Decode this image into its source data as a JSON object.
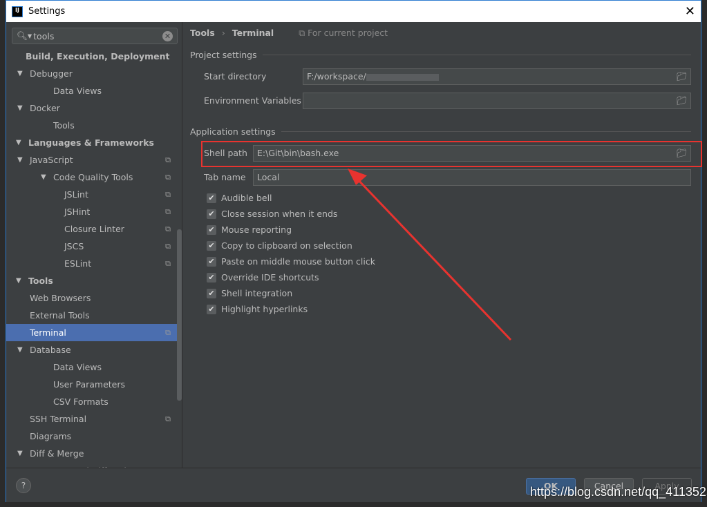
{
  "window": {
    "title": "Settings",
    "close": "✕",
    "logo": "IJ"
  },
  "search": {
    "value": "tools",
    "icon": "search-icon",
    "clear": "✕"
  },
  "tree": [
    {
      "label": "Build, Execution, Deployment",
      "level": 0,
      "bold": true
    },
    {
      "label": "Debugger",
      "level": 1,
      "arrow": "▼"
    },
    {
      "label": "Data Views",
      "level": 2
    },
    {
      "label": "Docker",
      "level": 1,
      "arrow": "▼"
    },
    {
      "label": "Tools",
      "level": 2
    },
    {
      "label": "Languages & Frameworks",
      "level": 0,
      "bold": true,
      "arrow": "▼"
    },
    {
      "label": "JavaScript",
      "level": 1,
      "arrow": "▼",
      "copy": true
    },
    {
      "label": "Code Quality Tools",
      "level": 2,
      "arrow": "▼",
      "copy": true
    },
    {
      "label": "JSLint",
      "level": 3,
      "copy": true
    },
    {
      "label": "JSHint",
      "level": 3,
      "copy": true
    },
    {
      "label": "Closure Linter",
      "level": 3,
      "copy": true
    },
    {
      "label": "JSCS",
      "level": 3,
      "copy": true
    },
    {
      "label": "ESLint",
      "level": 3,
      "copy": true
    },
    {
      "label": "Tools",
      "level": 0,
      "bold": true,
      "arrow": "▼"
    },
    {
      "label": "Web Browsers",
      "level": 1
    },
    {
      "label": "External Tools",
      "level": 1
    },
    {
      "label": "Terminal",
      "level": 1,
      "selected": true,
      "copy": true
    },
    {
      "label": "Database",
      "level": 1,
      "arrow": "▼"
    },
    {
      "label": "Data Views",
      "level": 2
    },
    {
      "label": "User Parameters",
      "level": 2
    },
    {
      "label": "CSV Formats",
      "level": 2
    },
    {
      "label": "SSH Terminal",
      "level": 1,
      "copy": true
    },
    {
      "label": "Diagrams",
      "level": 1
    },
    {
      "label": "Diff & Merge",
      "level": 1,
      "arrow": "▼"
    },
    {
      "label": "External Diff Tools",
      "level": 2
    }
  ],
  "breadcrumb": {
    "parent": "Tools",
    "sep": "›",
    "current": "Terminal",
    "scope": "For current project"
  },
  "project_settings": {
    "heading": "Project settings",
    "start_directory_label": "Start directory",
    "start_directory": "F:/workspace/",
    "env_label": "Environment Variables",
    "env_value": ""
  },
  "app_settings": {
    "heading": "Application settings",
    "shell_path_label": "Shell path",
    "shell_path": "E:\\Git\\bin\\bash.exe",
    "tab_name_label": "Tab name",
    "tab_name": "Local"
  },
  "checkboxes": [
    {
      "label": "Audible bell",
      "checked": true
    },
    {
      "label": "Close session when it ends",
      "checked": true
    },
    {
      "label": "Mouse reporting",
      "checked": true
    },
    {
      "label": "Copy to clipboard on selection",
      "checked": true
    },
    {
      "label": "Paste on middle mouse button click",
      "checked": true
    },
    {
      "label": "Override IDE shortcuts",
      "checked": true
    },
    {
      "label": "Shell integration",
      "checked": true
    },
    {
      "label": "Highlight hyperlinks",
      "checked": true
    }
  ],
  "footer": {
    "help": "?",
    "ok": "OK",
    "cancel": "Cancel",
    "apply": "Apply"
  },
  "watermark": "https://blog.csdn.net/qq_41135254",
  "colors": {
    "selection": "#4b6eaf",
    "highlight_box": "#e8332f",
    "ok_button": "#365880"
  }
}
